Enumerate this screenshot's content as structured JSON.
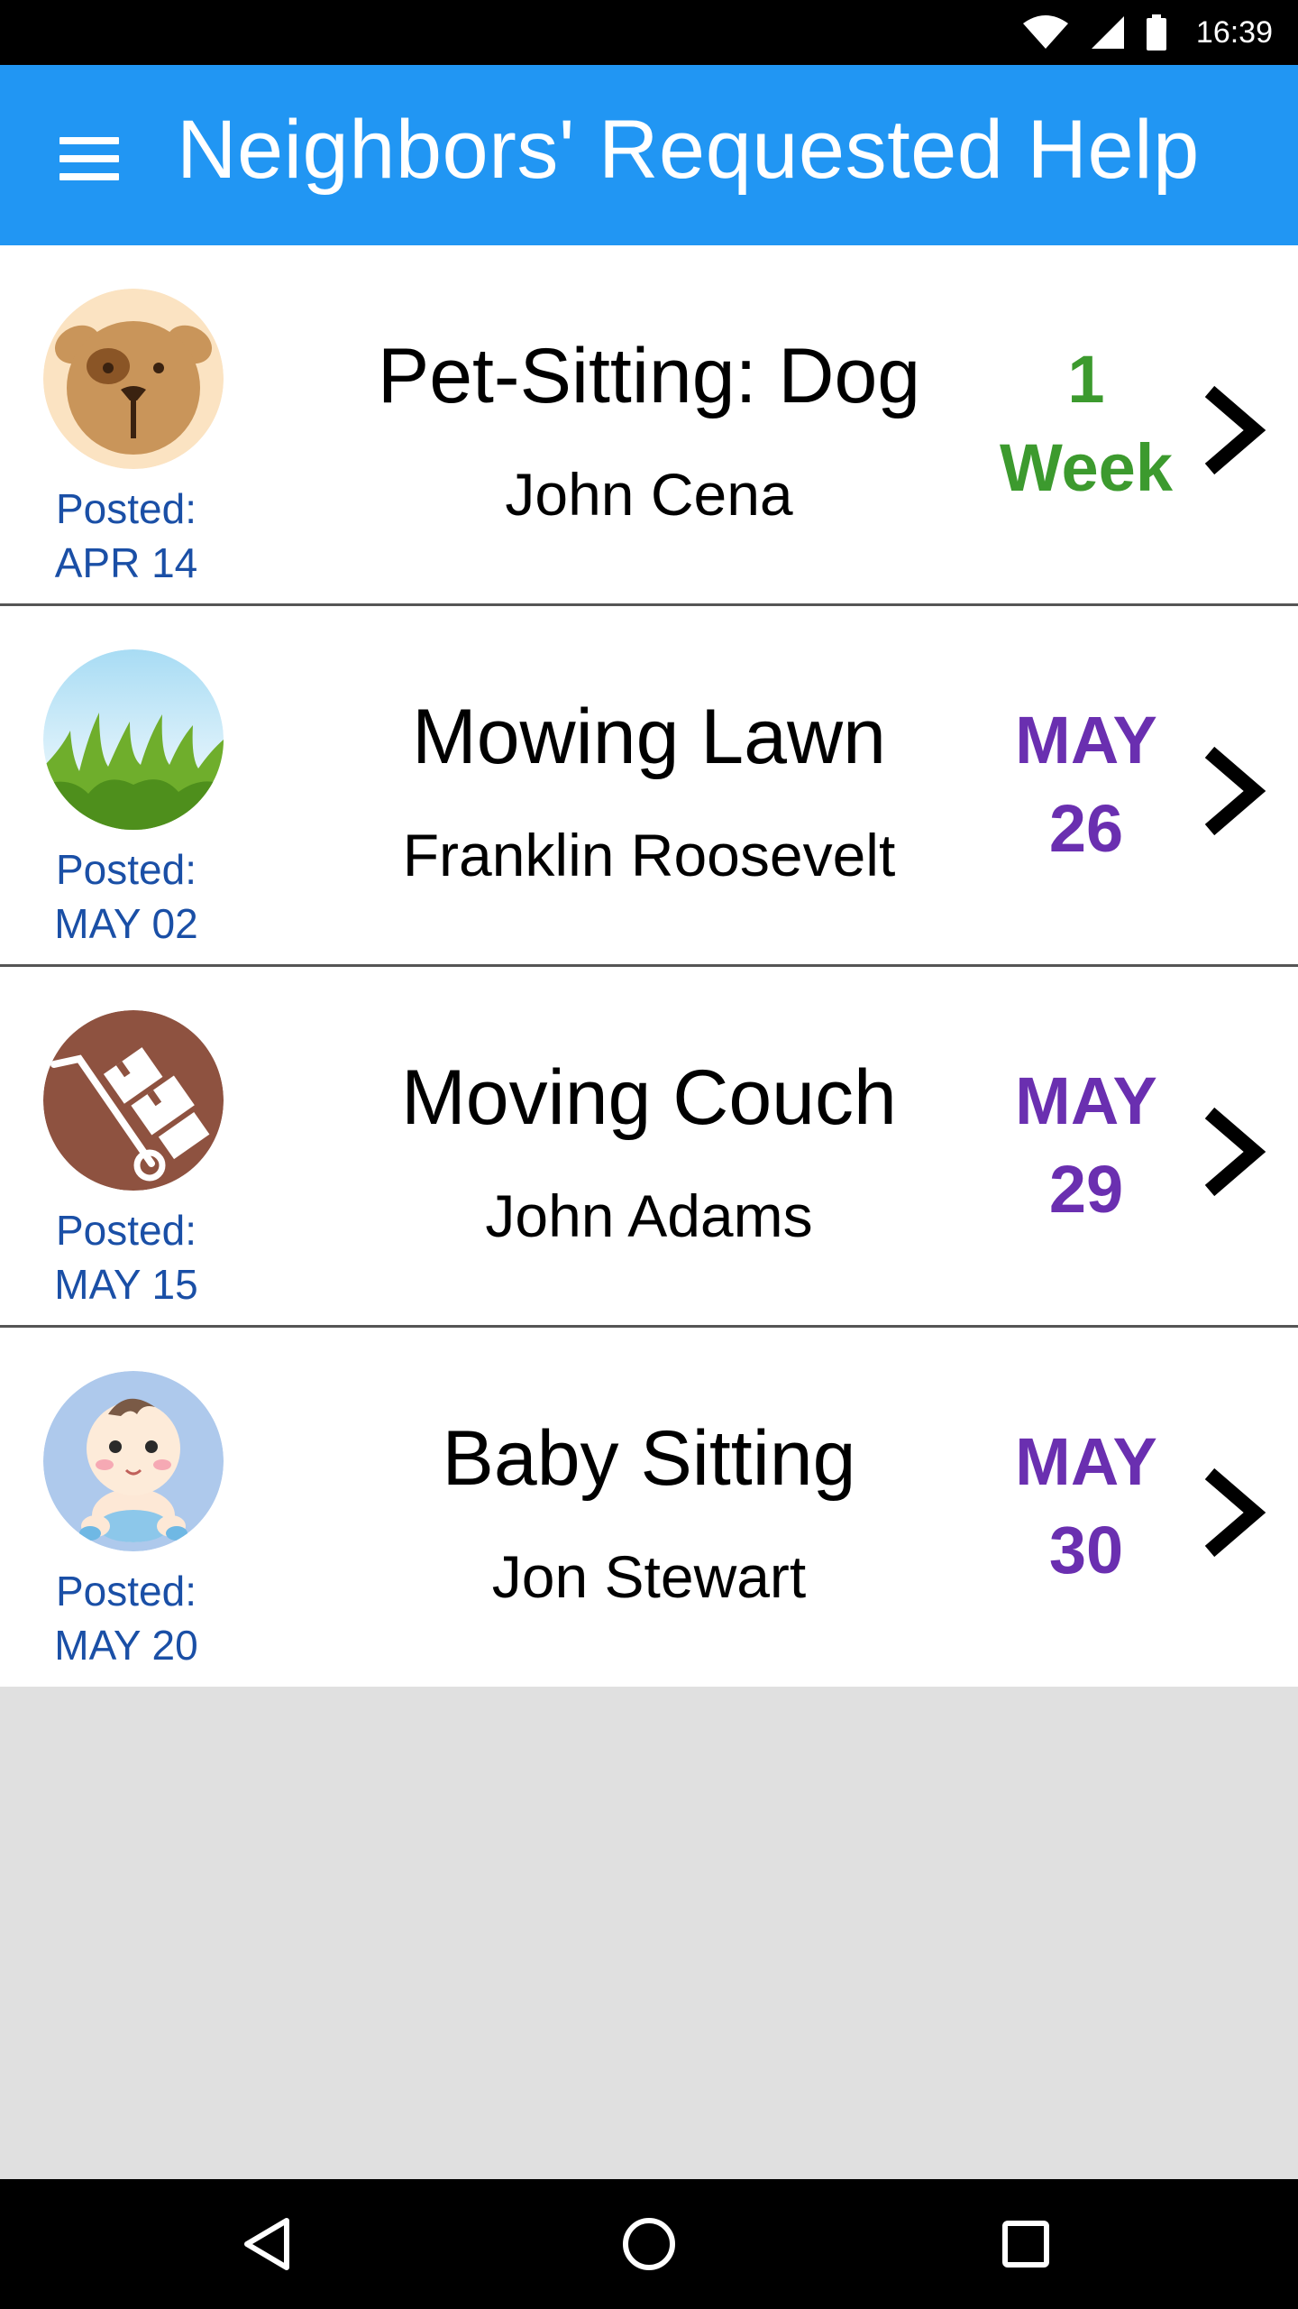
{
  "status_bar": {
    "time": "16:39",
    "icons": [
      "wifi-icon",
      "signal-icon",
      "battery-icon"
    ]
  },
  "app_bar": {
    "menu_icon": "menu-icon",
    "title": "Neighbors' Requested Help",
    "color": "#2196f3"
  },
  "requests": [
    {
      "title": "Pet-Sitting: Dog",
      "requester": "John Cena",
      "posted_label": "Posted:",
      "posted_date": "APR 14",
      "due_line1": "1",
      "due_line2": "Week",
      "due_color": "#3c9a2e",
      "icon": "dog-icon"
    },
    {
      "title": "Mowing Lawn",
      "requester": "Franklin Roosevelt",
      "posted_label": "Posted:",
      "posted_date": "MAY 02",
      "due_line1": "MAY",
      "due_line2": "26",
      "due_color": "#6a2fb0",
      "icon": "grass-icon"
    },
    {
      "title": "Moving Couch",
      "requester": "John Adams",
      "posted_label": "Posted:",
      "posted_date": "MAY 15",
      "due_line1": "MAY",
      "due_line2": "29",
      "due_color": "#6a2fb0",
      "icon": "hand-truck-icon"
    },
    {
      "title": "Baby Sitting",
      "requester": "Jon Stewart",
      "posted_label": "Posted:",
      "posted_date": "MAY 20",
      "due_line1": "MAY",
      "due_line2": "30",
      "due_color": "#6a2fb0",
      "icon": "baby-icon"
    }
  ],
  "nav_bar": {
    "buttons": [
      "back-icon",
      "home-icon",
      "recents-icon"
    ]
  }
}
